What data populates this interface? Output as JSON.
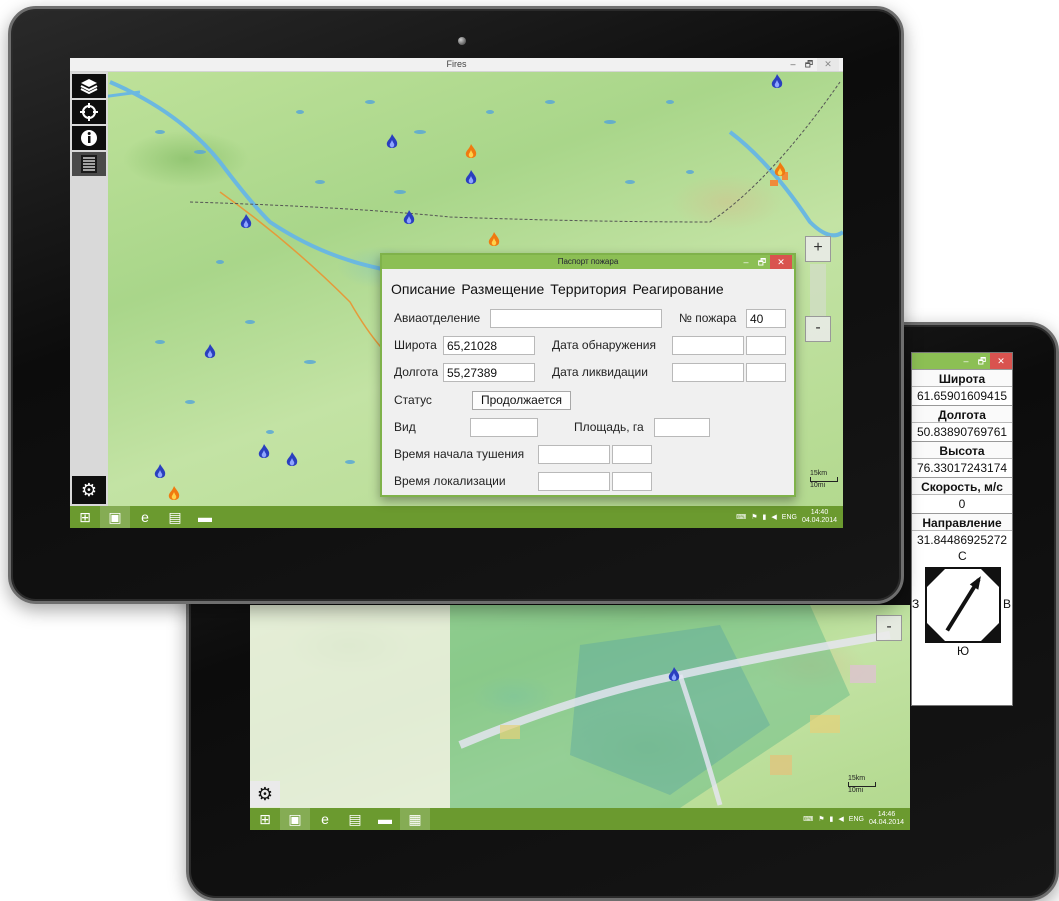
{
  "front": {
    "window_title": "Fires",
    "window_controls": {
      "minimize": "–",
      "restore": "🗗",
      "close": "✕"
    },
    "rail": {
      "layers_icon": "layers-icon",
      "locate_icon": "crosshair-icon",
      "info_icon": "info-icon",
      "list_icon": "list-icon",
      "settings_icon": "gear-icon"
    },
    "zoom": {
      "in": "+",
      "out": "-"
    },
    "scale": {
      "km": "15km",
      "mi": "10mi"
    },
    "taskbar": {
      "clock_time": "14:40",
      "clock_date": "04.04.2014",
      "lang": "ENG"
    }
  },
  "dialog": {
    "title": "Паспорт пожара",
    "tabs": [
      "Описание",
      "Размещение",
      "Территория",
      "Реагирование"
    ],
    "fields": {
      "aviadept_label": "Авиаотделение",
      "aviadept_value": "",
      "fire_no_label": "№ пожара",
      "fire_no_value": "40",
      "lat_label": "Широта",
      "lat_value": "65,21028",
      "detect_date_label": "Дата обнаружения",
      "lon_label": "Долгота",
      "lon_value": "55,27389",
      "liquid_date_label": "Дата ликвидации",
      "status_label": "Статус",
      "status_value": "Продолжается",
      "kind_label": "Вид",
      "area_label": "Площадь, га",
      "start_time_label": "Время начала тушения",
      "local_time_label": "Время локализации"
    }
  },
  "back": {
    "zoom_out": "-",
    "scale": {
      "km": "15km",
      "mi": "10mi"
    },
    "taskbar": {
      "clock_time": "14:46",
      "clock_date": "04.04.2014",
      "lang": "ENG"
    }
  },
  "info_panel": {
    "lat_label": "Широта",
    "lat_value": "61.65901609415",
    "lon_label": "Долгота",
    "lon_value": "50.83890769761",
    "alt_label": "Высота",
    "alt_value": "76.33017243174",
    "speed_label": "Скорость, м/с",
    "speed_value": "0",
    "dir_label": "Направление",
    "dir_value": "31.84486925272",
    "compass": {
      "n": "С",
      "s": "Ю",
      "w": "З",
      "e": "В"
    }
  },
  "colors": {
    "accent": "#8cbf54",
    "taskbar": "#6b9a2f",
    "close": "#d9534f",
    "fire_blue": "#2a3fbf",
    "fire_orange": "#f07a10"
  }
}
